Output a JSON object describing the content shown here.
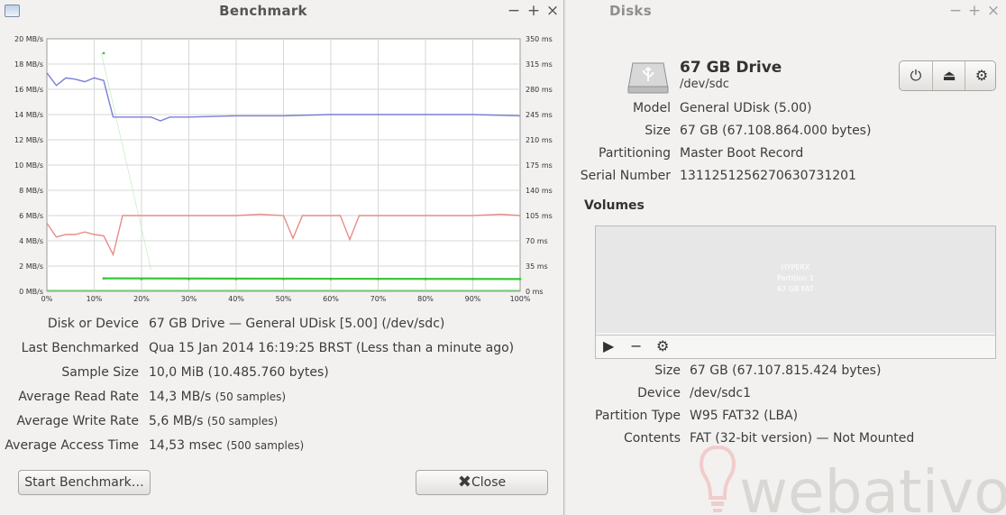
{
  "benchmark": {
    "title": "Benchmark",
    "window_buttons": {
      "minimize": "−",
      "maximize": "+",
      "close": "×"
    },
    "rows": [
      {
        "label": "Disk or Device",
        "value": "67 GB Drive — General UDisk [5.00] (/dev/sdc)",
        "note": ""
      },
      {
        "label": "Last Benchmarked",
        "value": "Qua 15 Jan 2014 16:19:25 BRST (Less than a minute ago)",
        "note": ""
      },
      {
        "label": "Sample Size",
        "value": "10,0 MiB (10.485.760 bytes)",
        "note": ""
      },
      {
        "label": "Average Read Rate",
        "value": "14,3 MB/s",
        "note": "(50 samples)"
      },
      {
        "label": "Average Write Rate",
        "value": "5,6 MB/s",
        "note": "(50 samples)"
      },
      {
        "label": "Average Access Time",
        "value": "14,53 msec",
        "note": "(500 samples)"
      }
    ],
    "start_button": "Start Benchmark…",
    "close_button": "Close",
    "colors": {
      "read": "#7b7fd2",
      "write": "#e88c89",
      "access": "#39c63a"
    }
  },
  "chart_data": {
    "type": "line",
    "x_ticks": [
      "0%",
      "10%",
      "20%",
      "30%",
      "40%",
      "50%",
      "60%",
      "70%",
      "80%",
      "90%",
      "100%"
    ],
    "y_left_ticks": [
      "0 MB/s",
      "2 MB/s",
      "4 MB/s",
      "6 MB/s",
      "8 MB/s",
      "10 MB/s",
      "12 MB/s",
      "14 MB/s",
      "16 MB/s",
      "18 MB/s",
      "20 MB/s"
    ],
    "y_right_ticks": [
      "0 ms",
      "35 ms",
      "70 ms",
      "105 ms",
      "140 ms",
      "175 ms",
      "210 ms",
      "245 ms",
      "280 ms",
      "315 ms",
      "350 ms"
    ],
    "xlim": [
      0,
      100
    ],
    "ylim_left": [
      0,
      20
    ],
    "ylim_right": [
      0,
      350
    ],
    "grid": true,
    "series": [
      {
        "axis": "left",
        "color": "#7b7fd2",
        "x": [
          0,
          2,
          4,
          6,
          8,
          10,
          12,
          14,
          16,
          18,
          20,
          22,
          24,
          26,
          28,
          30,
          40,
          50,
          60,
          70,
          80,
          90,
          100
        ],
        "values": [
          17.3,
          16.3,
          16.9,
          16.8,
          16.6,
          16.9,
          16.7,
          13.8,
          13.8,
          13.8,
          13.8,
          13.8,
          13.5,
          13.8,
          13.8,
          13.8,
          13.9,
          13.9,
          14.0,
          14.0,
          14.0,
          14.0,
          13.9
        ]
      },
      {
        "axis": "left",
        "color": "#e88c89",
        "x": [
          0,
          2,
          4,
          6,
          8,
          10,
          12,
          14,
          16,
          20,
          30,
          40,
          45,
          50,
          52,
          54,
          60,
          62,
          64,
          66,
          70,
          80,
          90,
          96,
          100
        ],
        "values": [
          5.4,
          4.3,
          4.5,
          4.5,
          4.7,
          4.5,
          4.4,
          2.9,
          6.0,
          6.0,
          6.0,
          6.0,
          6.1,
          6.0,
          4.2,
          6.0,
          6.0,
          6.0,
          4.1,
          6.0,
          6.0,
          6.0,
          6.0,
          6.1,
          6.0
        ]
      }
    ],
    "access_x": [
      12,
      20,
      30,
      40,
      50,
      60,
      70,
      80,
      90,
      100
    ],
    "access_ms": [
      18,
      17,
      17,
      17,
      17,
      17,
      17,
      17,
      17,
      17
    ]
  },
  "disks": {
    "title": "Disks",
    "window_buttons": {
      "minimize": "−",
      "maximize": "+",
      "close": "×"
    },
    "drive_name": "67 GB Drive",
    "drive_path": "/dev/sdc",
    "info": [
      {
        "label": "Model",
        "value": "General UDisk (5.00)"
      },
      {
        "label": "Size",
        "value": "67 GB (67.108.864.000 bytes)"
      },
      {
        "label": "Partitioning",
        "value": "Master Boot Record"
      },
      {
        "label": "Serial Number",
        "value": "1311251256270630731201"
      }
    ],
    "volumes_heading": "Volumes",
    "partition_lines": [
      "HYPERX",
      "Partition 1",
      "67 GB FAT"
    ],
    "volume_info": [
      {
        "label": "Size",
        "value": "67 GB (67.107.815.424 bytes)"
      },
      {
        "label": "Device",
        "value": "/dev/sdc1"
      },
      {
        "label": "Partition Type",
        "value": "W95 FAT32 (LBA)"
      },
      {
        "label": "Contents",
        "value": "FAT (32-bit version) — Not Mounted"
      }
    ],
    "toolbar_icons": [
      "power-icon",
      "eject-icon",
      "gear-icon"
    ],
    "watermark": "webativo"
  }
}
